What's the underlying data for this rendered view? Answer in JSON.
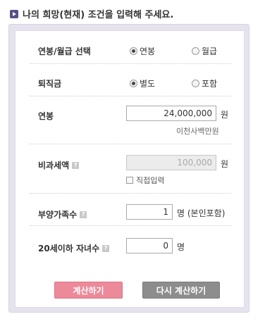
{
  "header": {
    "title": "나의 희망(현재) 조건을 입력해 주세요.",
    "icon": "arrow-bullet-icon",
    "accent": "#5a4d86"
  },
  "form": {
    "salary_type": {
      "label": "연봉/월급 선택",
      "options": [
        "연봉",
        "월급"
      ],
      "selected": "연봉"
    },
    "severance": {
      "label": "퇴직금",
      "options": [
        "별도",
        "포함"
      ],
      "selected": "별도"
    },
    "annual_salary": {
      "label": "연봉",
      "value": "24,000,000",
      "unit": "원",
      "hint": "이천사백만원"
    },
    "nontaxable": {
      "label": "비과세액",
      "value": "100,000",
      "unit": "원",
      "direct_input_label": "직접입력"
    },
    "dependents": {
      "label": "부양가족수",
      "value": "1",
      "unit": "명 (본인포함)"
    },
    "children": {
      "label": "20세이하 자녀수",
      "value": "0",
      "unit": "명"
    }
  },
  "buttons": {
    "calculate": "계산하기",
    "reset": "다시 계산하기",
    "calculate_color": "#ec8a9a",
    "reset_color": "#8d8d8d"
  }
}
